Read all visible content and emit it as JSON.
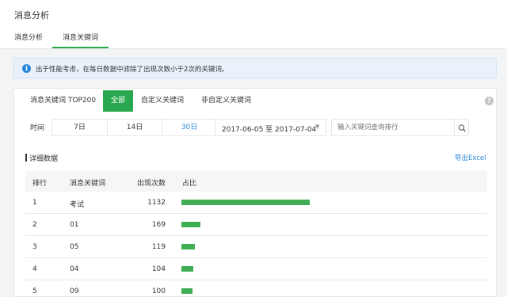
{
  "header": {
    "title": "消息分析",
    "tabs": [
      {
        "label": "消息分析"
      },
      {
        "label": "消息关键词"
      }
    ]
  },
  "notice": {
    "icon": "info-icon",
    "text": "出于性能考虑，在每日数据中滤除了出现次数小于2次的关键词。"
  },
  "filters": {
    "tabs": [
      {
        "label": "消息关键词 TOP200"
      },
      {
        "label": "全部"
      },
      {
        "label": "自定义关键词"
      },
      {
        "label": "非自定义关键词"
      }
    ],
    "help_icon": "?",
    "time_label": "时间",
    "date_buttons": [
      {
        "label": "7日"
      },
      {
        "label": "14日"
      },
      {
        "label": "30日"
      }
    ],
    "date_range": "2017-06-05 至 2017-07-04",
    "search_placeholder": "输入关键词查询排行"
  },
  "detail": {
    "title": "详细数据",
    "export_label": "导出Excel",
    "columns": [
      "排行",
      "消息关键词",
      "出现次数",
      "占比"
    ],
    "accent_color": "#3fae55",
    "rows": [
      {
        "rank": "1",
        "keyword": "考试",
        "count": "1132",
        "share": 1.0
      },
      {
        "rank": "2",
        "keyword": "01",
        "count": "169",
        "share": 0.149
      },
      {
        "rank": "3",
        "keyword": "05",
        "count": "119",
        "share": 0.105
      },
      {
        "rank": "4",
        "keyword": "04",
        "count": "104",
        "share": 0.092
      },
      {
        "rank": "5",
        "keyword": "09",
        "count": "100",
        "share": 0.088
      }
    ]
  }
}
